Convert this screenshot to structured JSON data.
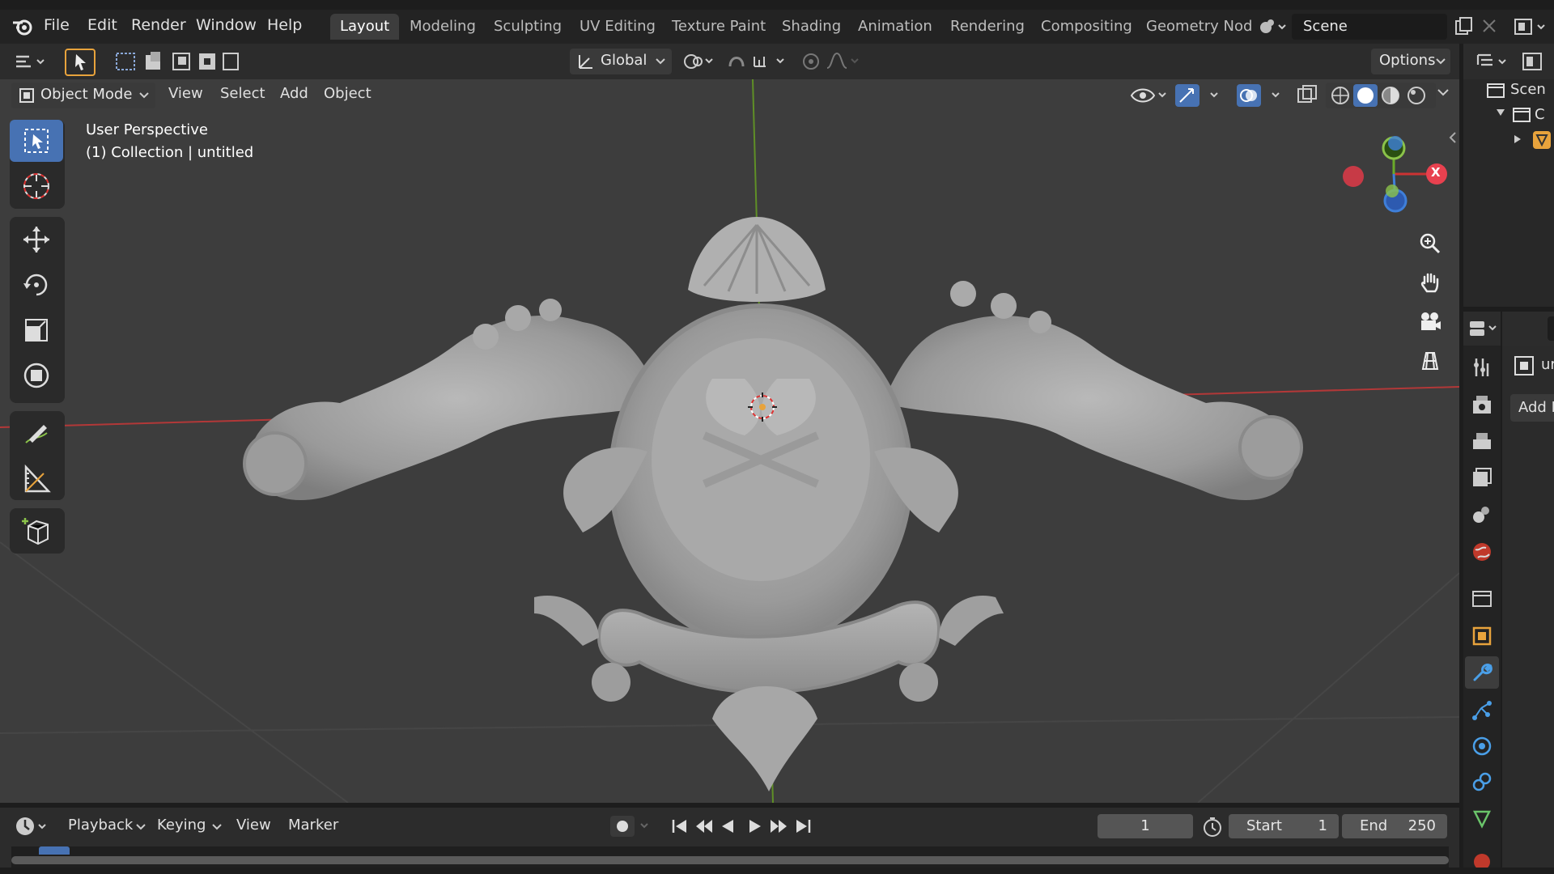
{
  "menubar": {
    "items": [
      "File",
      "Edit",
      "Render",
      "Window",
      "Help"
    ]
  },
  "workspaces": {
    "tabs": [
      "Layout",
      "Modeling",
      "Sculpting",
      "UV Editing",
      "Texture Paint",
      "Shading",
      "Animation",
      "Rendering",
      "Compositing",
      "Geometry Nod"
    ],
    "active": "Layout"
  },
  "scene": {
    "name": "Scene"
  },
  "tool_header": {
    "orientation": "Global",
    "options_label": "Options"
  },
  "viewport_header": {
    "mode": "Object Mode",
    "menus": [
      "View",
      "Select",
      "Add",
      "Object"
    ]
  },
  "viewport": {
    "perspective": "User Perspective",
    "collection": "(1) Collection | untitled",
    "gizmo_x_label": "X"
  },
  "timeline": {
    "menus": [
      "Playback",
      "Keying",
      "View",
      "Marker"
    ],
    "current_frame": "1",
    "start_label": "Start",
    "start_value": "1",
    "end_label": "End",
    "end_value": "250"
  },
  "outliner": {
    "scene_label": "Scen",
    "collection_label": "C"
  },
  "properties": {
    "object_name": "ur",
    "add_modifier": "Add M"
  },
  "colors": {
    "accent": "#4772b3",
    "axis_x": "#c23a3a",
    "axis_y": "#6a9a2a",
    "gizmo_x": "#e8414f",
    "gizmo_y": "#8bc34a",
    "gizmo_z": "#3f7fd9"
  }
}
